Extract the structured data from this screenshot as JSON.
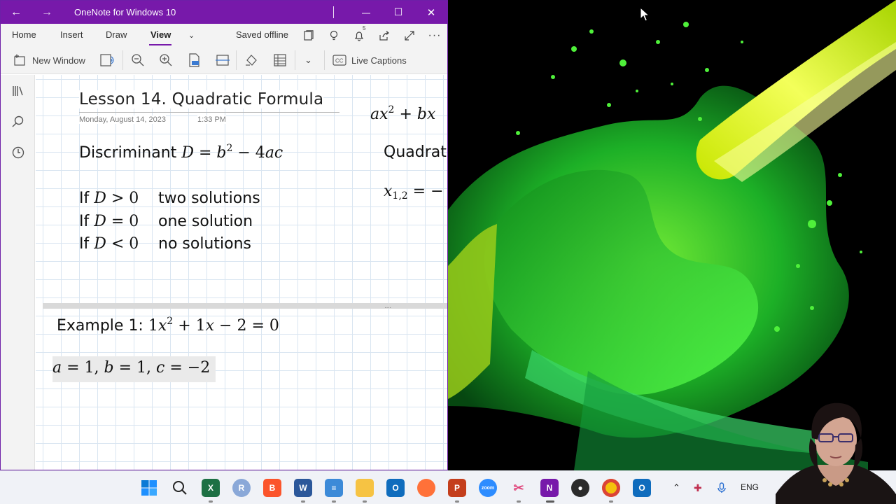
{
  "window": {
    "title": "OneNote for Windows 10",
    "back_label": "←",
    "forward_label": "→",
    "minimize_label": "—",
    "maximize_label": "☐",
    "close_label": "✕"
  },
  "menu": {
    "items": [
      "Home",
      "Insert",
      "Draw",
      "View"
    ],
    "active": "View",
    "status": "Saved offline"
  },
  "toolbar": {
    "new_window_label": "New Window",
    "live_captions_label": "Live Captions"
  },
  "page": {
    "title": "Lesson 14. Quadratic Formula",
    "date": "Monday, August 14, 2023",
    "time": "1:33 PM",
    "discriminant_word": "Discriminant",
    "if_word": "If",
    "cases": [
      {
        "relation": ">",
        "result": "two solutions"
      },
      {
        "relation": "=",
        "result": "one solution"
      },
      {
        "relation": "<",
        "result": "no solutions"
      }
    ],
    "example_label": "Example 1:",
    "right_col_eq_fragment": "ax² + bx",
    "right_col_heading_fragment": "Quadrat",
    "right_col_x_fragment": "x₁,₂ = −"
  },
  "taskbar": {
    "icons": [
      "windows-start",
      "search",
      "excel",
      "r",
      "brave",
      "word",
      "notepad",
      "file-explorer",
      "outlook",
      "firefox",
      "powerpoint",
      "zoom",
      "snipping-tool",
      "onenote",
      "obs",
      "chrome",
      "outlook-new"
    ],
    "language": "ENG",
    "badge_count": "5"
  },
  "colors": {
    "onenote_purple": "#7719aa",
    "grid_line": "#d9e5f1",
    "wallpaper_green": "#3fdc2a"
  }
}
